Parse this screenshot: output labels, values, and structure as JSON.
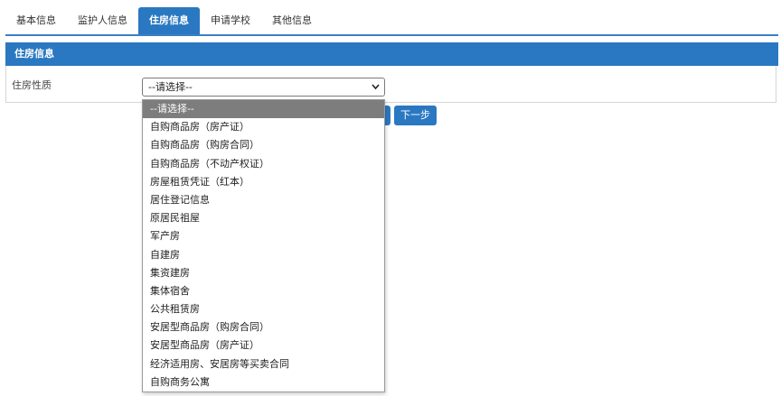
{
  "tabs": [
    {
      "label": "基本信息"
    },
    {
      "label": "监护人信息"
    },
    {
      "label": "住房信息"
    },
    {
      "label": "申请学校"
    },
    {
      "label": "其他信息"
    }
  ],
  "panel": {
    "title": "住房信息",
    "field_label": "住房性质",
    "select_value": "--请选择--"
  },
  "buttons": {
    "next_label": "下一步"
  },
  "dropdown": {
    "options": [
      "--请选择--",
      "自购商品房（房产证）",
      "自购商品房（购房合同）",
      "自购商品房（不动产权证）",
      "房屋租赁凭证（红本）",
      "居住登记信息",
      "原居民祖屋",
      "军产房",
      "自建房",
      "集资建房",
      "集体宿舍",
      "公共租赁房",
      "安居型商品房（购房合同）",
      "安居型商品房（房产证）",
      "经济适用房、安居房等买卖合同",
      "自购商务公寓"
    ]
  },
  "colors": {
    "accent": "#2a78c1",
    "selected_option": "#7d7d7d"
  },
  "icons": {
    "select_arrow": "chevron-down-icon"
  }
}
